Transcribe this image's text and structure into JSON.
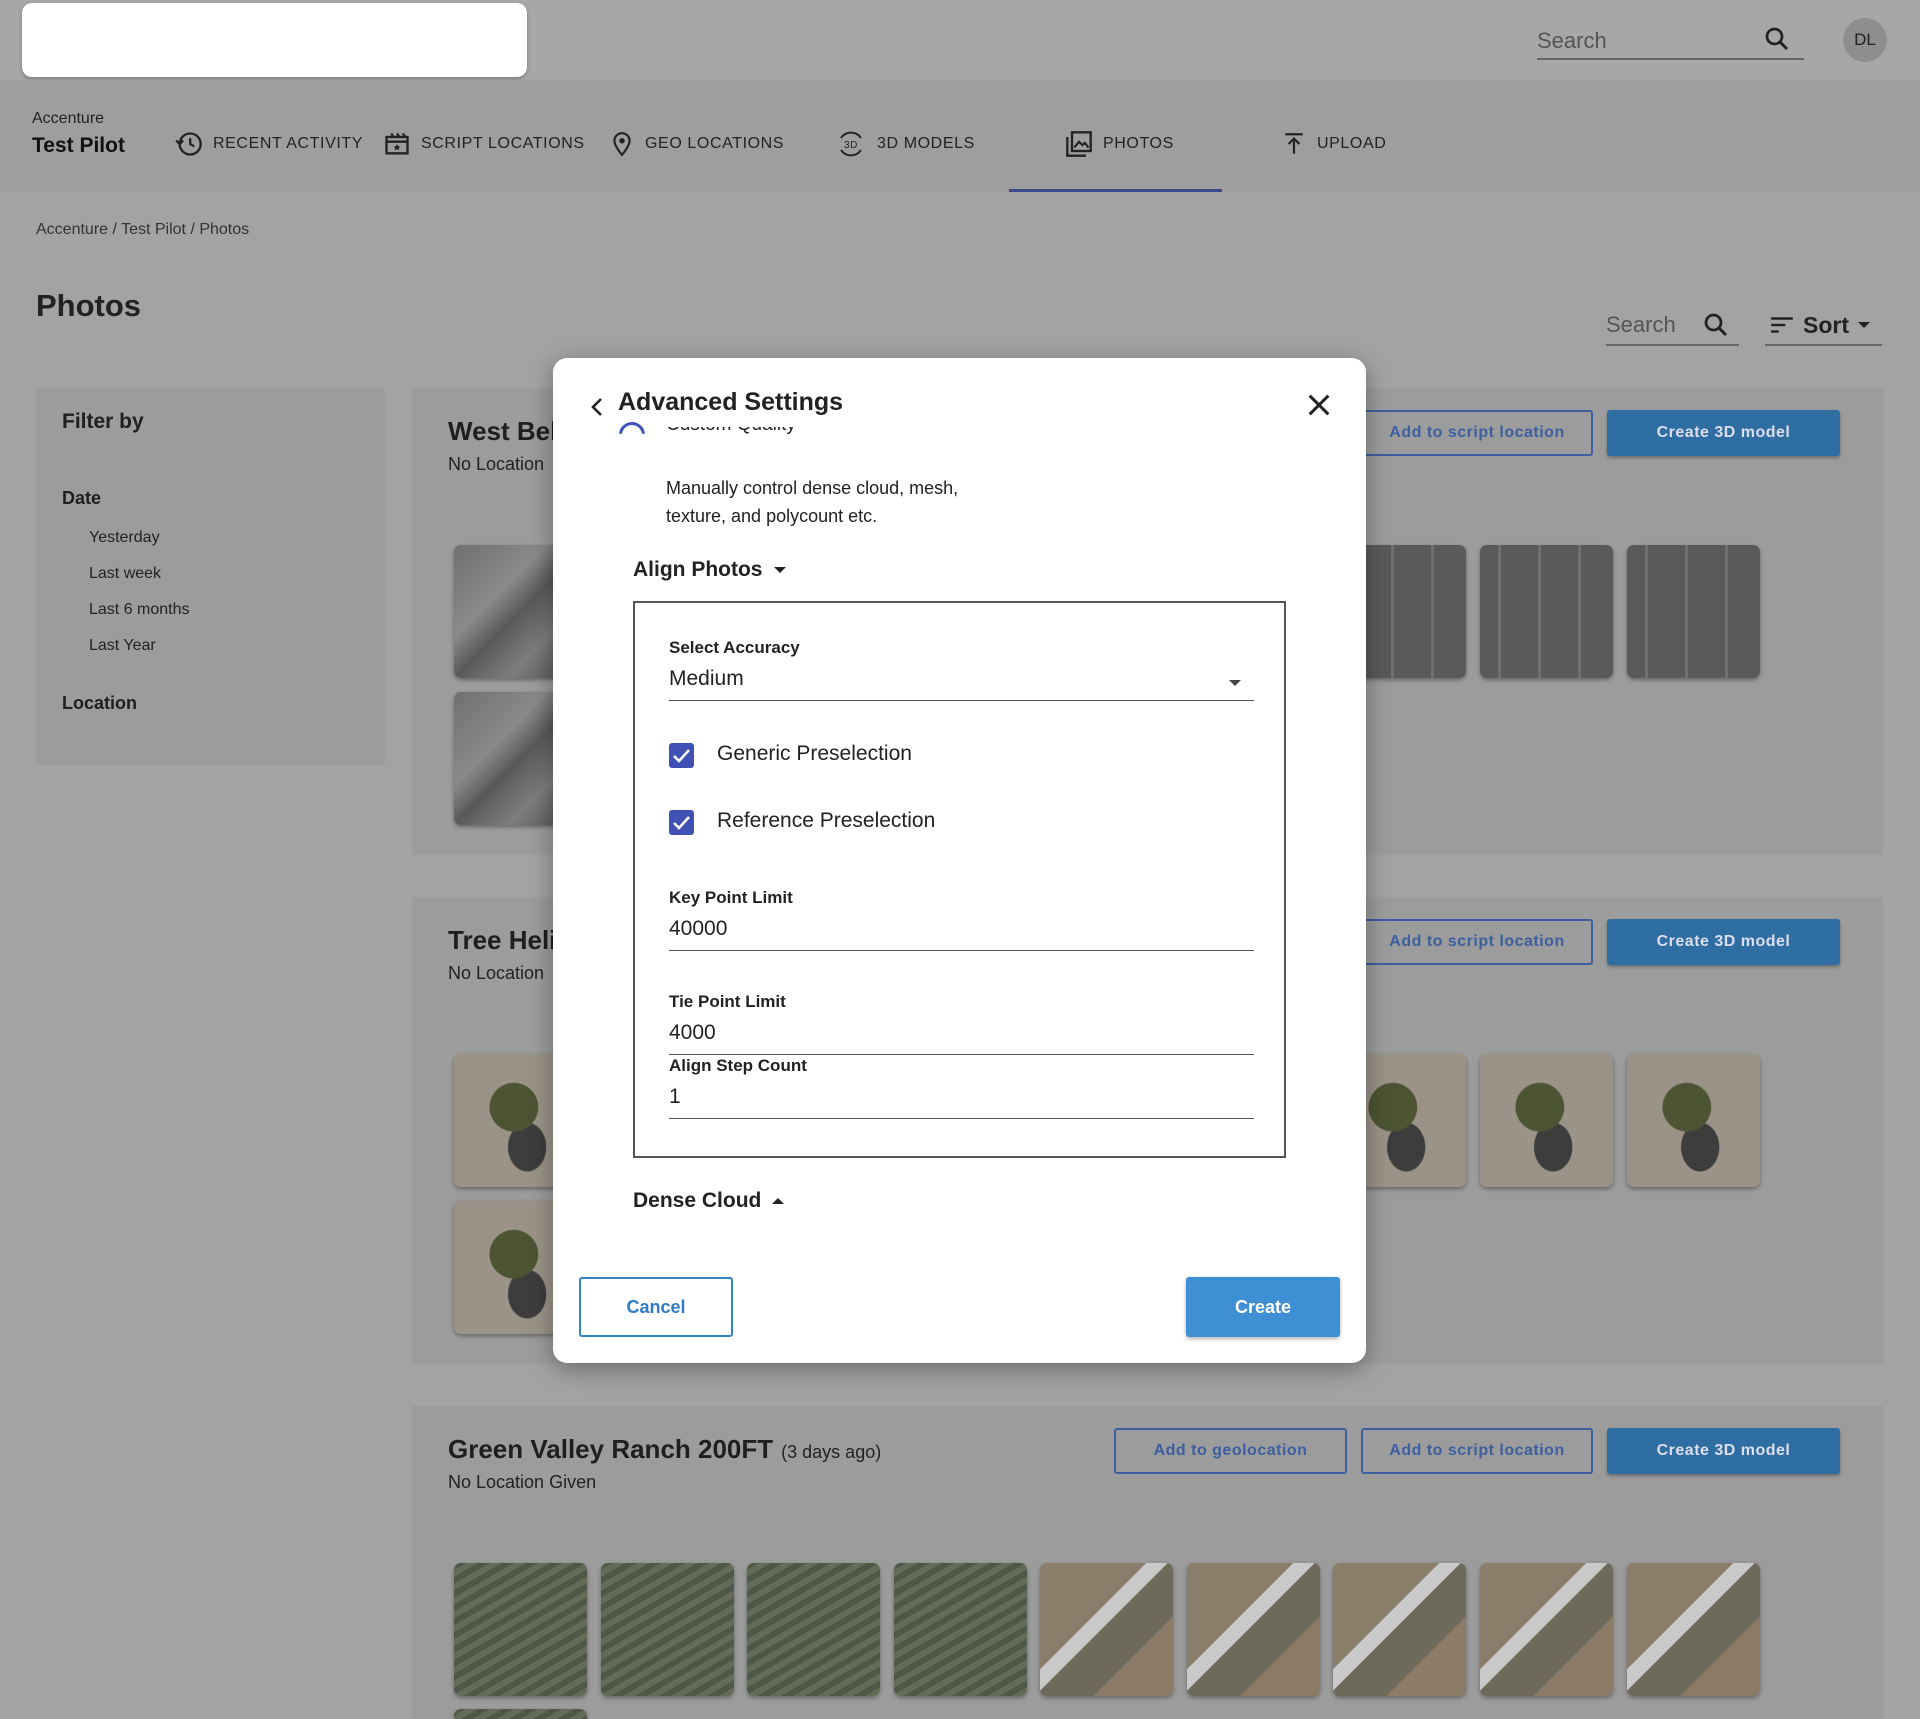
{
  "topbar": {
    "search_placeholder": "Search",
    "avatar_initials": "DL"
  },
  "nav": {
    "org": "Accenture",
    "project": "Test Pilot",
    "items": [
      {
        "label": "RECENT ACTIVITY",
        "icon": "history-icon"
      },
      {
        "label": "SCRIPT LOCATIONS",
        "icon": "clapperboard-icon"
      },
      {
        "label": "GEO LOCATIONS",
        "icon": "map-pin-icon"
      },
      {
        "label": "3D MODELS",
        "icon": "3d-rotate-icon"
      },
      {
        "label": "PHOTOS",
        "icon": "photo-library-icon",
        "active": true
      },
      {
        "label": "UPLOAD",
        "icon": "upload-icon"
      }
    ]
  },
  "breadcrumb": "Accenture / Test Pilot / Photos",
  "page": {
    "title": "Photos",
    "search_placeholder": "Search",
    "sort_label": "Sort"
  },
  "filter": {
    "title": "Filter by",
    "date_heading": "Date",
    "date_options": [
      "Yesterday",
      "Last week",
      "Last 6 months",
      "Last Year"
    ],
    "location_heading": "Location"
  },
  "groups": [
    {
      "title": "West Bel",
      "time": "",
      "location": "No Location",
      "buttons": {
        "script": "Add to script location",
        "model": "Create 3D model"
      }
    },
    {
      "title": "Tree Heli",
      "time": "",
      "location": "No Location",
      "buttons": {
        "script": "Add to script location",
        "model": "Create 3D model"
      }
    },
    {
      "title": "Green Valley Ranch 200FT",
      "time": "(3 days ago)",
      "location": "No Location Given",
      "buttons": {
        "geo": "Add to geolocation",
        "script": "Add to script location",
        "model": "Create 3D model"
      }
    }
  ],
  "modal": {
    "title": "Advanced Settings",
    "radio_label": "Custom Quality",
    "description": "Manually control dense cloud, mesh, texture, and polycount etc.",
    "align_section": "Align Photos",
    "select_accuracy_label": "Select Accuracy",
    "select_accuracy_value": "Medium",
    "generic_preselection": "Generic Preselection",
    "reference_preselection": "Reference Preselection",
    "key_point_limit_label": "Key Point Limit",
    "key_point_limit_value": "40000",
    "tie_point_limit_label": "Tie Point Limit",
    "tie_point_limit_value": "4000",
    "align_step_count_label": "Align Step Count",
    "align_step_count_value": "1",
    "dense_cloud_section": "Dense Cloud",
    "cancel_label": "Cancel",
    "create_label": "Create"
  },
  "colors": {
    "accent": "#3f51b5",
    "primary_button": "#3e8fd3",
    "overlay": "#a3a3a3"
  }
}
